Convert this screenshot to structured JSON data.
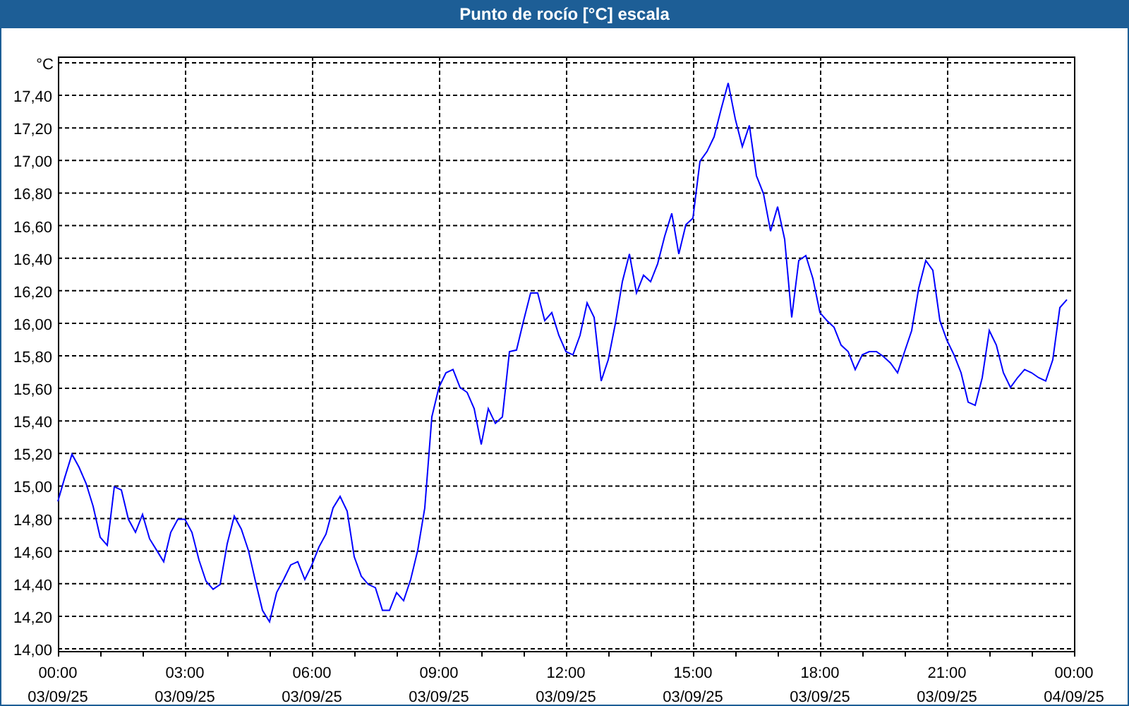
{
  "window": {
    "title": "Punto de rocío [°C] escala"
  },
  "chart": {
    "chart_data": {
      "type": "line",
      "ylabel": "°C",
      "grid": true,
      "categories": [
        "00:00\n03/09/25",
        null,
        null,
        null,
        null,
        null,
        null,
        null,
        null,
        null,
        null,
        null,
        null,
        null,
        null,
        null,
        null,
        null,
        "03:00\n03/09/25",
        null,
        null,
        null,
        null,
        null,
        null,
        null,
        null,
        null,
        null,
        null,
        null,
        null,
        null,
        null,
        null,
        null,
        "06:00\n03/09/25",
        null,
        null,
        null,
        null,
        null,
        null,
        null,
        null,
        null,
        null,
        null,
        null,
        null,
        null,
        null,
        null,
        null,
        "09:00\n03/09/25",
        null,
        null,
        null,
        null,
        null,
        null,
        null,
        null,
        null,
        null,
        null,
        null,
        null,
        null,
        null,
        null,
        null,
        "12:00\n03/09/25",
        null,
        null,
        null,
        null,
        null,
        null,
        null,
        null,
        null,
        null,
        null,
        null,
        null,
        null,
        null,
        null,
        null,
        "15:00\n03/09/25",
        null,
        null,
        null,
        null,
        null,
        null,
        null,
        null,
        null,
        null,
        null,
        null,
        null,
        null,
        null,
        null,
        null,
        "18:00\n03/09/25",
        null,
        null,
        null,
        null,
        null,
        null,
        null,
        null,
        null,
        null,
        null,
        null,
        null,
        null,
        null,
        null,
        null,
        "21:00\n03/09/25",
        null,
        null,
        null,
        null,
        null,
        null,
        null,
        null,
        null,
        null,
        null,
        null,
        null,
        null,
        null,
        null,
        null,
        "00:00\n04/09/25"
      ],
      "series": [
        {
          "color": "#0000ff",
          "values": [
            14.91,
            15.06,
            15.2,
            15.12,
            15.02,
            14.88,
            14.69,
            14.64,
            15.0,
            14.98,
            14.8,
            14.72,
            14.83,
            14.68,
            14.61,
            14.54,
            14.72,
            14.8,
            14.8,
            14.72,
            14.55,
            14.42,
            14.37,
            14.4,
            14.65,
            14.82,
            14.74,
            14.61,
            14.42,
            14.24,
            14.17,
            14.35,
            14.43,
            14.52,
            14.54,
            14.43,
            14.52,
            14.63,
            14.71,
            14.87,
            14.94,
            14.85,
            14.57,
            14.45,
            14.4,
            14.38,
            14.24,
            14.24,
            14.35,
            14.3,
            14.43,
            14.61,
            14.87,
            15.43,
            15.61,
            15.7,
            15.72,
            15.61,
            15.58,
            15.48,
            15.26,
            15.48,
            15.39,
            15.43,
            15.83,
            15.84,
            16.02,
            16.19,
            16.19,
            16.02,
            16.07,
            15.93,
            15.83,
            15.81,
            15.93,
            16.13,
            16.04,
            15.65,
            15.78,
            16.0,
            16.26,
            16.43,
            16.19,
            16.3,
            16.26,
            16.37,
            16.54,
            16.68,
            16.43,
            16.61,
            16.65,
            17.0,
            17.06,
            17.15,
            17.32,
            17.48,
            17.26,
            17.09,
            17.22,
            16.91,
            16.8,
            16.57,
            16.72,
            16.52,
            16.04,
            16.39,
            16.42,
            16.28,
            16.07,
            16.02,
            15.98,
            15.87,
            15.83,
            15.72,
            15.81,
            15.83,
            15.83,
            15.8,
            15.76,
            15.7,
            15.83,
            15.96,
            16.22,
            16.39,
            16.33,
            16.02,
            15.9,
            15.81,
            15.7,
            15.52,
            15.5,
            15.67,
            15.96,
            15.87,
            15.7,
            15.61,
            15.67,
            15.72,
            15.7,
            15.67,
            15.65,
            15.78,
            16.1,
            16.15,
            null
          ]
        }
      ],
      "ylim": [
        14,
        17.6
      ],
      "yticks": [
        {
          "value": 14,
          "label": "14,00"
        },
        {
          "value": 14.2,
          "label": "14,20"
        },
        {
          "value": 14.4,
          "label": "14,40"
        },
        {
          "value": 14.6,
          "label": "14,60"
        },
        {
          "value": 14.8,
          "label": "14,80"
        },
        {
          "value": 15,
          "label": "15,00"
        },
        {
          "value": 15.2,
          "label": "15,20"
        },
        {
          "value": 15.4,
          "label": "15,40"
        },
        {
          "value": 15.6,
          "label": "15,60"
        },
        {
          "value": 15.8,
          "label": "15,80"
        },
        {
          "value": 16,
          "label": "16,00"
        },
        {
          "value": 16.2,
          "label": "16,20"
        },
        {
          "value": 16.4,
          "label": "16,40"
        },
        {
          "value": 16.6,
          "label": "16,60"
        },
        {
          "value": 16.8,
          "label": "16,80"
        },
        {
          "value": 17,
          "label": "17,00"
        },
        {
          "value": 17.2,
          "label": "17,20"
        },
        {
          "value": 17.4,
          "label": "17,40"
        }
      ]
    }
  }
}
